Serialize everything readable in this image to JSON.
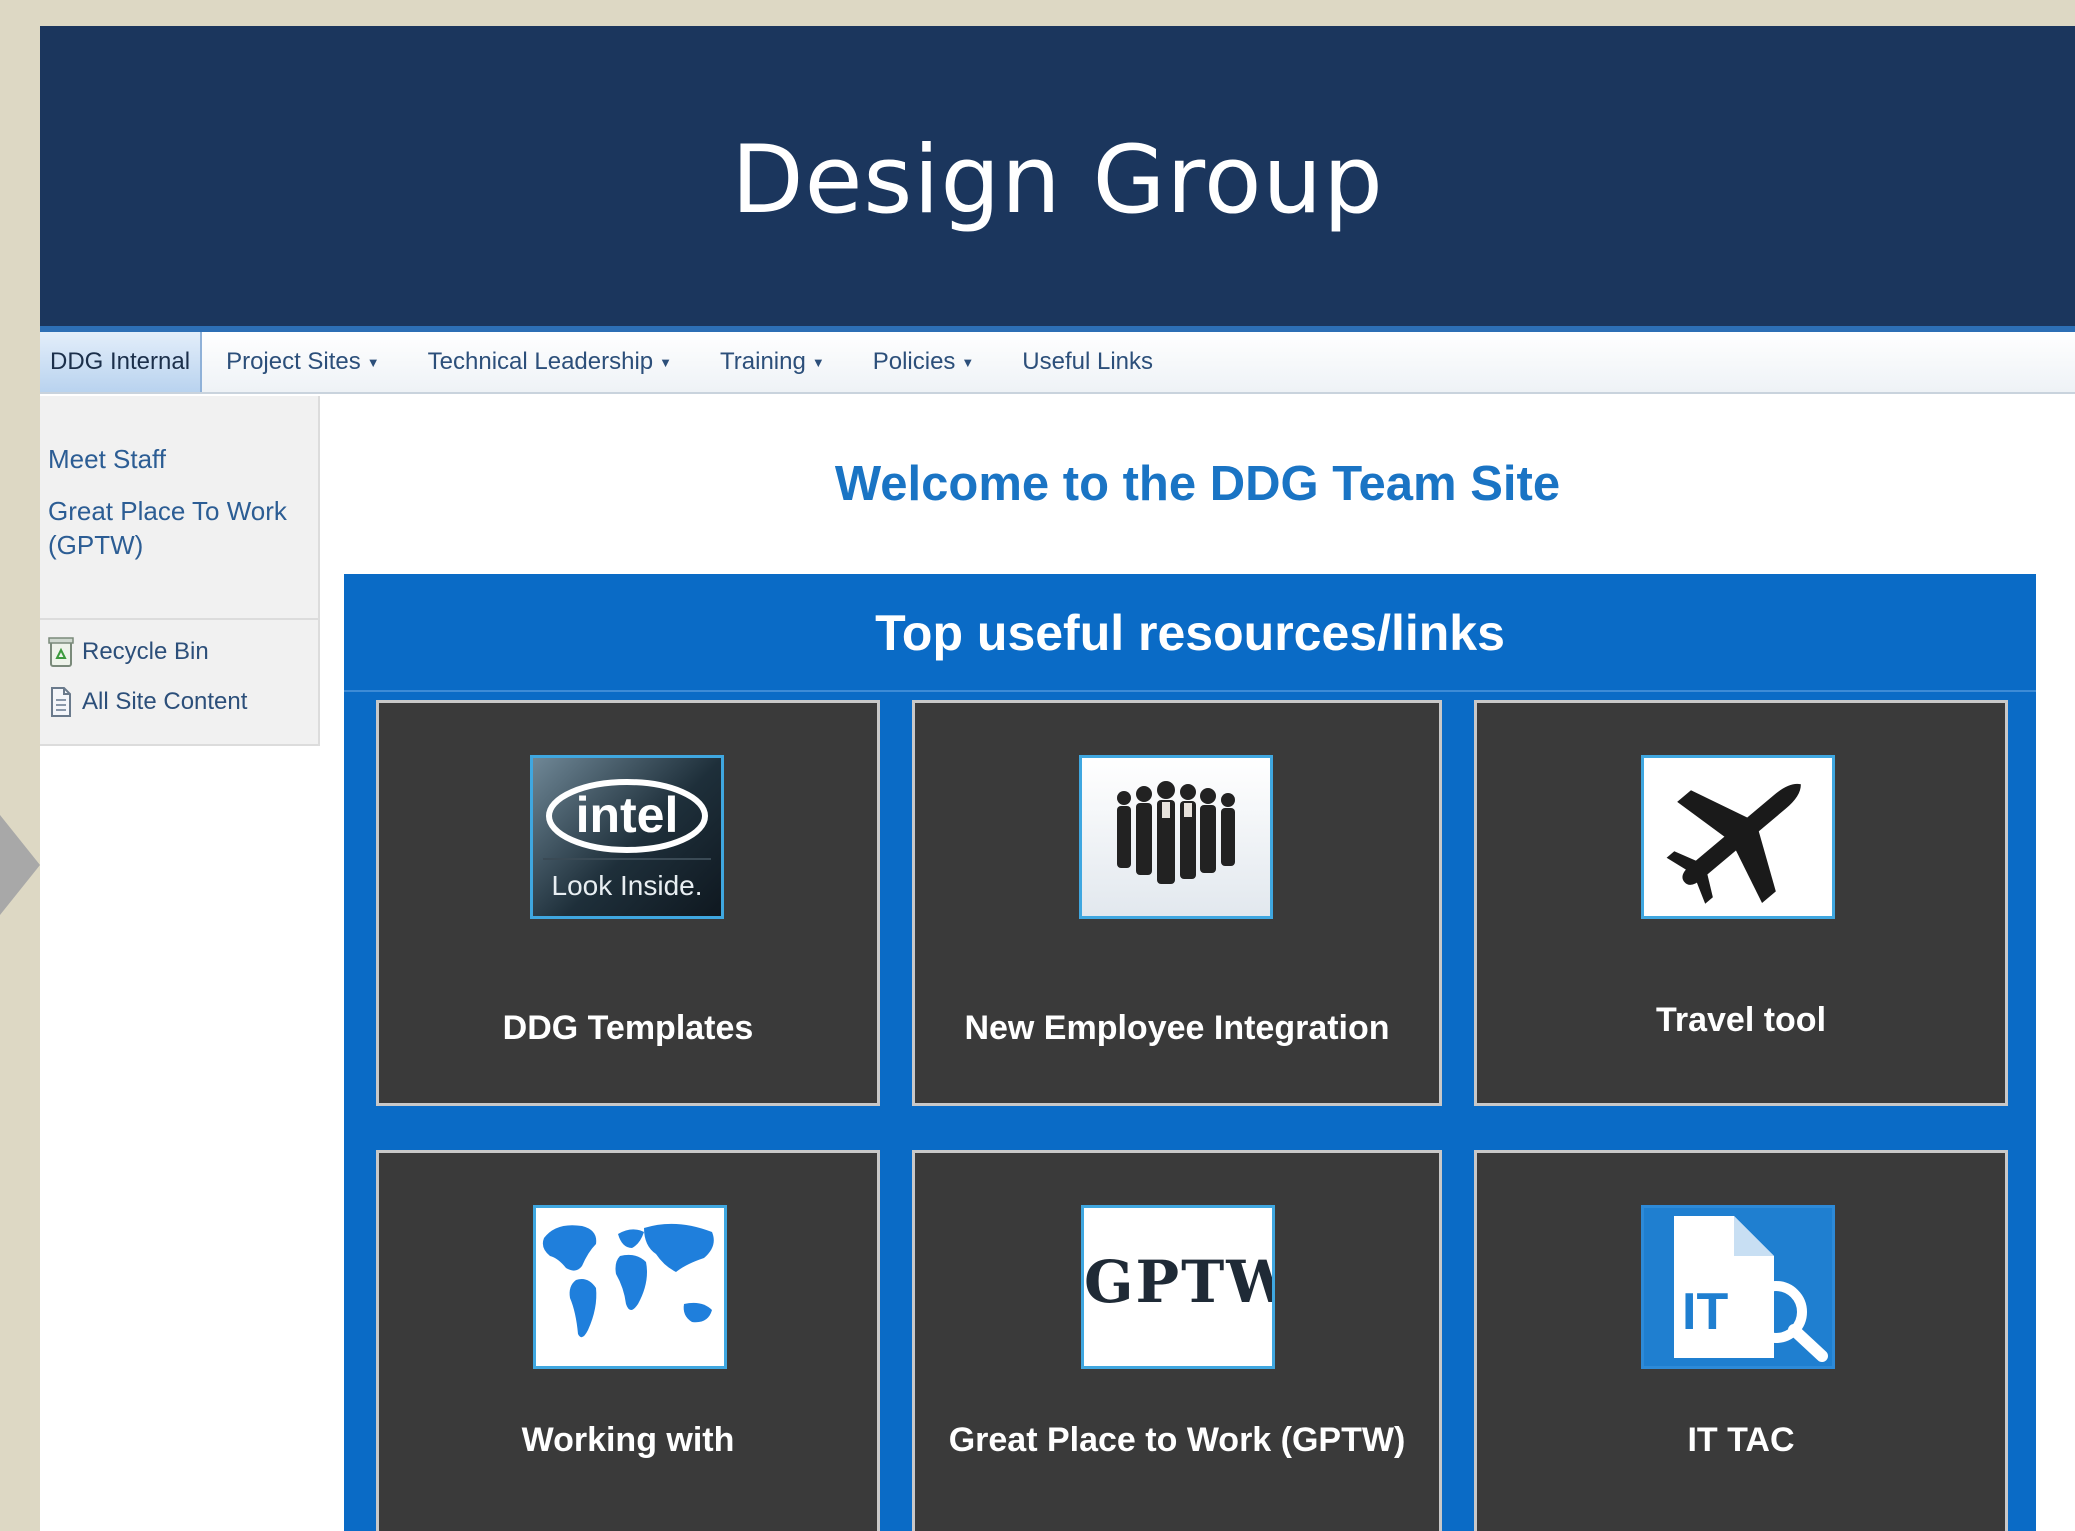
{
  "banner": {
    "title": "Design Group"
  },
  "navbar": {
    "items": [
      {
        "label": "DDG Internal",
        "dropdown": false,
        "active": true
      },
      {
        "label": "Project Sites",
        "dropdown": true
      },
      {
        "label": "Technical Leadership",
        "dropdown": true
      },
      {
        "label": "Training",
        "dropdown": true
      },
      {
        "label": "Policies",
        "dropdown": true
      },
      {
        "label": "Useful Links",
        "dropdown": false
      }
    ],
    "caret": "▼"
  },
  "left_nav": {
    "links": [
      "Meet Staff",
      "Great Place To Work",
      "(GPTW)"
    ],
    "utilities": [
      {
        "label": "Recycle Bin",
        "icon": "recycle-bin-icon"
      },
      {
        "label": "All Site Content",
        "icon": "site-content-icon"
      }
    ]
  },
  "main": {
    "welcome": "Welcome to the DDG Team Site",
    "resources_title": "Top useful resources/links",
    "tiles": [
      {
        "label": "DDG Templates",
        "icon": "intel-logo-image",
        "logo_text": "intel",
        "logo_tagline": "Look Inside."
      },
      {
        "label": "New Employee Integration",
        "icon": "business-people-image"
      },
      {
        "label": "Travel tool",
        "icon": "airplane-icon"
      },
      {
        "label": "Working with",
        "icon": "world-map-image"
      },
      {
        "label": "Great Place to Work (GPTW)",
        "icon": "gptw-logo-image",
        "logo_text": "GPTW"
      },
      {
        "label": "IT TAC",
        "icon": "it-document-search-icon",
        "logo_text": "IT"
      }
    ]
  },
  "colors": {
    "banner": "#1b365d",
    "resources_panel": "#0a6bc6",
    "tile_bg": "#3a3a3a",
    "welcome_text": "#1a74c4"
  }
}
